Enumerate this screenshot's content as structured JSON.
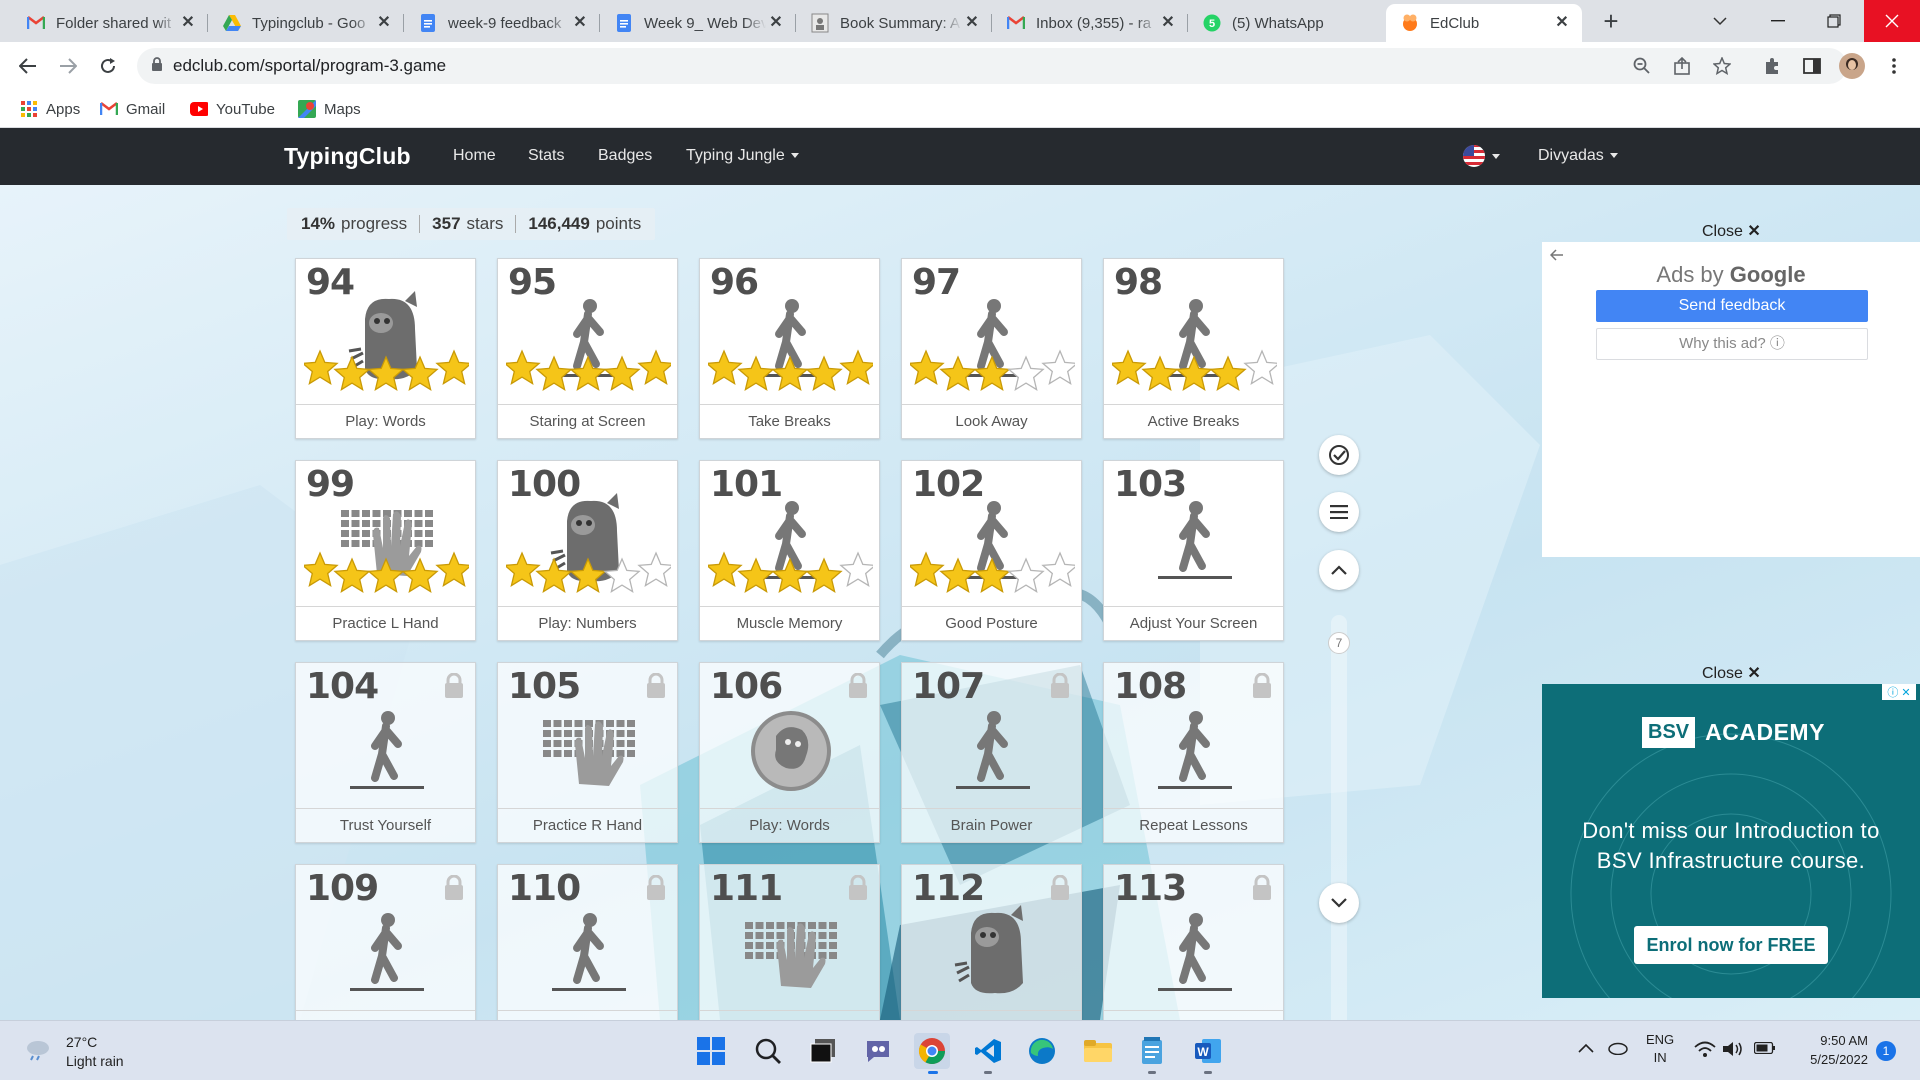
{
  "tabs": [
    {
      "title": "Folder shared wit",
      "icon": "gmail-icon"
    },
    {
      "title": "Typingclub - Goo",
      "icon": "drive-icon"
    },
    {
      "title": "week-9 feedback",
      "icon": "docs-icon"
    },
    {
      "title": "Week 9_ Web Dev",
      "icon": "docs-icon"
    },
    {
      "title": "Book Summary: A",
      "icon": "book-icon"
    },
    {
      "title": "Inbox (9,355) - ra",
      "icon": "gmail-icon"
    },
    {
      "title": "(5) WhatsApp",
      "icon": "whatsapp-icon"
    },
    {
      "title": "EdClub",
      "icon": "edclub-icon"
    }
  ],
  "toolbar": {
    "url": "edclub.com/sportal/program-3.game"
  },
  "bookmarks": [
    {
      "label": "Apps",
      "icon": "apps-grid-icon"
    },
    {
      "label": "Gmail",
      "icon": "gmail-icon"
    },
    {
      "label": "YouTube",
      "icon": "youtube-icon"
    },
    {
      "label": "Maps",
      "icon": "maps-icon"
    }
  ],
  "site": {
    "logo": "TypingClub",
    "nav": [
      "Home",
      "Stats",
      "Badges",
      "Typing Jungle"
    ],
    "user": "Divyadas"
  },
  "stats": {
    "progress_value": "14%",
    "progress_label": "progress",
    "stars_value": "357",
    "stars_label": "stars",
    "points_value": "146,449",
    "points_label": "points"
  },
  "lessons": [
    {
      "num": "94",
      "label": "Play: Words",
      "stars": 5,
      "icon": "monster",
      "locked": false
    },
    {
      "num": "95",
      "label": "Staring at Screen",
      "stars": 5,
      "icon": "walker",
      "locked": false
    },
    {
      "num": "96",
      "label": "Take Breaks",
      "stars": 5,
      "icon": "walker",
      "locked": false
    },
    {
      "num": "97",
      "label": "Look Away",
      "stars": 3,
      "icon": "walker",
      "locked": false
    },
    {
      "num": "98",
      "label": "Active Breaks",
      "stars": 4,
      "icon": "walker",
      "locked": false
    },
    {
      "num": "99",
      "label": "Practice L Hand",
      "stars": 5,
      "icon": "keyboard",
      "locked": false
    },
    {
      "num": "100",
      "label": "Play: Numbers",
      "stars": 3,
      "icon": "monster",
      "locked": false
    },
    {
      "num": "101",
      "label": "Muscle Memory",
      "stars": 4,
      "icon": "walker",
      "locked": false
    },
    {
      "num": "102",
      "label": "Good Posture",
      "stars": 3,
      "icon": "walker",
      "locked": false
    },
    {
      "num": "103",
      "label": "Adjust Your Screen",
      "stars": 0,
      "icon": "walker",
      "locked": false
    },
    {
      "num": "104",
      "label": "Trust Yourself",
      "stars": 0,
      "icon": "walker",
      "locked": true
    },
    {
      "num": "105",
      "label": "Practice R Hand",
      "stars": 0,
      "icon": "keyboard",
      "locked": true
    },
    {
      "num": "106",
      "label": "Play: Words",
      "stars": 0,
      "icon": "bubble",
      "locked": true
    },
    {
      "num": "107",
      "label": "Brain Power",
      "stars": 0,
      "icon": "walker",
      "locked": true
    },
    {
      "num": "108",
      "label": "Repeat Lessons",
      "stars": 0,
      "icon": "walker",
      "locked": true
    },
    {
      "num": "109",
      "label": "",
      "stars": 0,
      "icon": "walker",
      "locked": true
    },
    {
      "num": "110",
      "label": "",
      "stars": 0,
      "icon": "walker",
      "locked": true
    },
    {
      "num": "111",
      "label": "",
      "stars": 0,
      "icon": "keyboard",
      "locked": true
    },
    {
      "num": "112",
      "label": "",
      "stars": 0,
      "icon": "monster",
      "locked": true
    },
    {
      "num": "113",
      "label": "",
      "stars": 0,
      "icon": "walker",
      "locked": true
    }
  ],
  "side": {
    "scroll_number": "7"
  },
  "ad1": {
    "close": "Close",
    "ads_by": "Ads by",
    "google": "Google",
    "send_feedback": "Send feedback",
    "why": "Why this ad? ⓘ"
  },
  "ad2": {
    "close": "Close",
    "logo_box": "BSV",
    "logo_text": "ACADEMY",
    "line1": "Don't miss our Introduction to",
    "line2": "BSV Infrastructure course.",
    "cta": "Enrol now for FREE"
  },
  "taskbar": {
    "temp": "27°C",
    "weather": "Light rain",
    "lang1": "ENG",
    "lang2": "IN",
    "time": "9:50 AM",
    "date": "5/25/2022",
    "notif": "1"
  }
}
